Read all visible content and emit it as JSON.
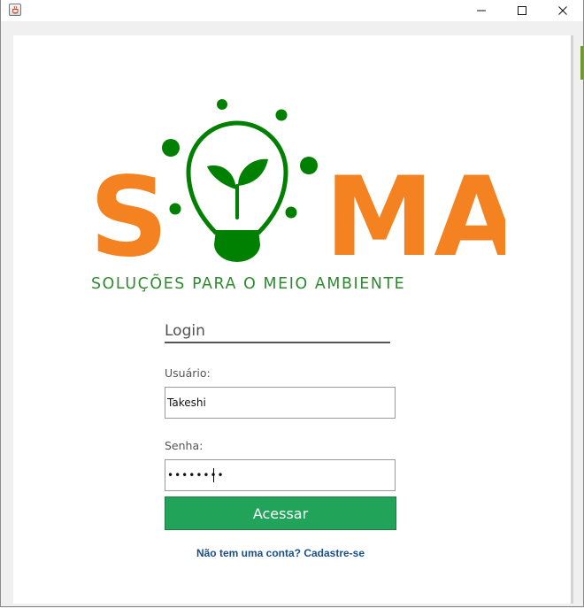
{
  "window": {
    "app_icon": "java-coffee-icon",
    "controls": {
      "minimize_icon": "minimize-icon",
      "maximize_icon": "maximize-icon",
      "close_icon": "close-icon"
    }
  },
  "logo": {
    "letters": [
      "S",
      "MA"
    ],
    "bulb_icon": "lightbulb-sprout-icon",
    "tagline": "SOLUÇÕES PARA O MEIO AMBIENTE",
    "colors": {
      "orange": "#f58220",
      "green": "#008000",
      "tagline": "#2f8a2f"
    }
  },
  "form": {
    "title": "Login",
    "user_label": "Usuário:",
    "user_value": "Takeshi",
    "pass_label": "Senha:",
    "pass_value": "Takeshi1",
    "submit_label": "Acessar",
    "signup_link": "Não tem uma conta? Cadastre-se",
    "colors": {
      "button": "#22a35a",
      "link": "#1a4f8a"
    }
  }
}
